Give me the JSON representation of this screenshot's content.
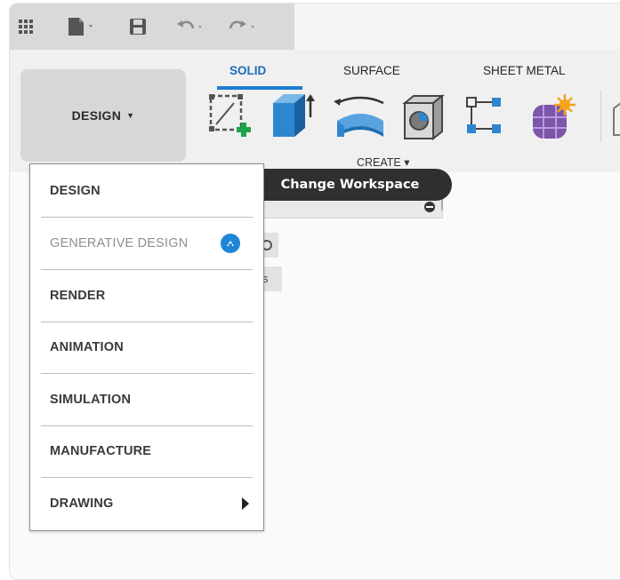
{
  "workspace_button": {
    "label": "DESIGN",
    "caret": "▼"
  },
  "ribbon": {
    "tabs": [
      {
        "label": "SOLID",
        "active": true
      },
      {
        "label": "SURFACE",
        "active": false
      },
      {
        "label": "SHEET METAL",
        "active": false
      }
    ],
    "group_label": "CREATE ▾"
  },
  "tooltip": {
    "text": "Change Workspace"
  },
  "workspace_menu": {
    "items": [
      {
        "label": "DESIGN"
      },
      {
        "label": "GENERATIVE DESIGN"
      },
      {
        "label": "RENDER"
      },
      {
        "label": "ANIMATION"
      },
      {
        "label": "SIMULATION"
      },
      {
        "label": "MANUFACTURE"
      },
      {
        "label": "DRAWING"
      }
    ]
  },
  "background": {
    "partial_text": "s"
  },
  "colors": {
    "accent": "#1b7bd0",
    "tooltip_bg": "#2f2f2f",
    "menu_border": "#8d8d8d"
  }
}
